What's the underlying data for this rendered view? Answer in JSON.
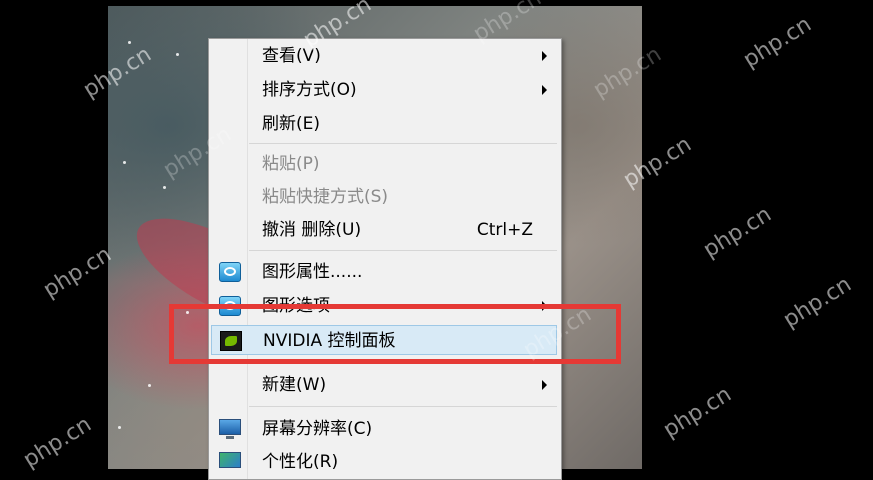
{
  "context_menu": {
    "items": [
      {
        "label": "查看(V)",
        "submenu": true,
        "enabled": true
      },
      {
        "label": "排序方式(O)",
        "submenu": true,
        "enabled": true
      },
      {
        "label": "刷新(E)",
        "submenu": false,
        "enabled": true
      },
      {
        "label": "粘贴(P)",
        "submenu": false,
        "enabled": false
      },
      {
        "label": "粘贴快捷方式(S)",
        "submenu": false,
        "enabled": false
      },
      {
        "label": "撤消 删除(U)",
        "shortcut": "Ctrl+Z",
        "enabled": true
      },
      {
        "label": "图形属性......",
        "icon": "intel-graphics-icon",
        "enabled": true
      },
      {
        "label": "图形选项",
        "icon": "intel-graphics-icon",
        "submenu": true,
        "enabled": true
      },
      {
        "label": "NVIDIA 控制面板",
        "icon": "nvidia-icon",
        "highlighted": true,
        "enabled": true
      },
      {
        "label": "新建(W)",
        "submenu": true,
        "enabled": true
      },
      {
        "label": "屏幕分辨率(C)",
        "icon": "monitor-icon",
        "enabled": true
      },
      {
        "label": "个性化(R)",
        "icon": "personalize-icon",
        "enabled": true
      }
    ]
  },
  "watermark": "php.cn",
  "colors": {
    "annotation_border": "#e53935",
    "menu_background": "#f1f1f1",
    "highlight_background": "#d8eaf6"
  }
}
